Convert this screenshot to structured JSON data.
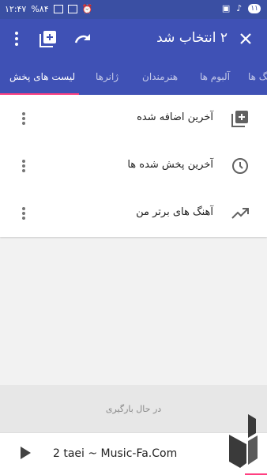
{
  "status_bar": {
    "time": "۱۲:۴۷",
    "battery": "%۸۴",
    "notification_count": "۱۱"
  },
  "toolbar": {
    "title": "۲ انتخاب شد"
  },
  "tabs": [
    {
      "label": "لیست های پخش",
      "active": true
    },
    {
      "label": "ژانرها",
      "active": false
    },
    {
      "label": "هنرمندان",
      "active": false
    },
    {
      "label": "آلبوم ها",
      "active": false
    },
    {
      "label": "آهنگ ها",
      "active": false
    }
  ],
  "playlists": [
    {
      "label": "آخرین اضافه شده",
      "icon": "playlist-add-icon"
    },
    {
      "label": "آخرین پخش شده ها",
      "icon": "history-icon"
    },
    {
      "label": "آهنگ های برتر من",
      "icon": "trending-up-icon"
    }
  ],
  "loading": {
    "text": "در حال بارگیری"
  },
  "player": {
    "song": "2 taei ~ Music-Fa.Com"
  },
  "colors": {
    "primary": "#3f51b5",
    "accent": "#ff4081"
  }
}
